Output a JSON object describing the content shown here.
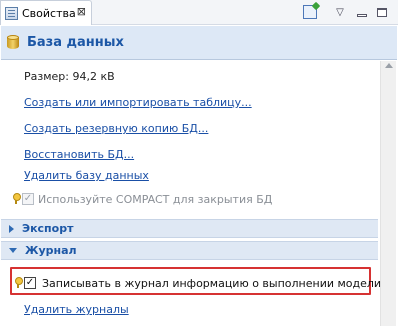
{
  "tab": {
    "label": "Свойства",
    "close_glyph": "⊠",
    "icon": "properties-icon"
  },
  "toolbar": {
    "menu_glyph": "▽"
  },
  "header": {
    "title": "База данных",
    "icon": "database-icon"
  },
  "info": {
    "size_label": "Размер: 94,2 кВ"
  },
  "links": {
    "create_table": "Создать или импортировать таблицу...",
    "backup": "Создать резервную копию БД...",
    "restore": "Восстановить БД...",
    "delete_db": "Удалить базу данных",
    "delete_logs": "Удалить журналы"
  },
  "options": {
    "compact_label": "Используйте COMPACT для закрытия БД",
    "compact_checked": true,
    "compact_enabled": false,
    "journal_label": "Записывать в журнал информацию о выполнении модели",
    "journal_checked": true
  },
  "sections": {
    "export": {
      "title": "Экспорт",
      "expanded": false
    },
    "journal": {
      "title": "Журнал",
      "expanded": true
    }
  },
  "colors": {
    "link": "#1a4fa6",
    "header_text": "#1c57a6",
    "highlight_border": "#d63232"
  }
}
